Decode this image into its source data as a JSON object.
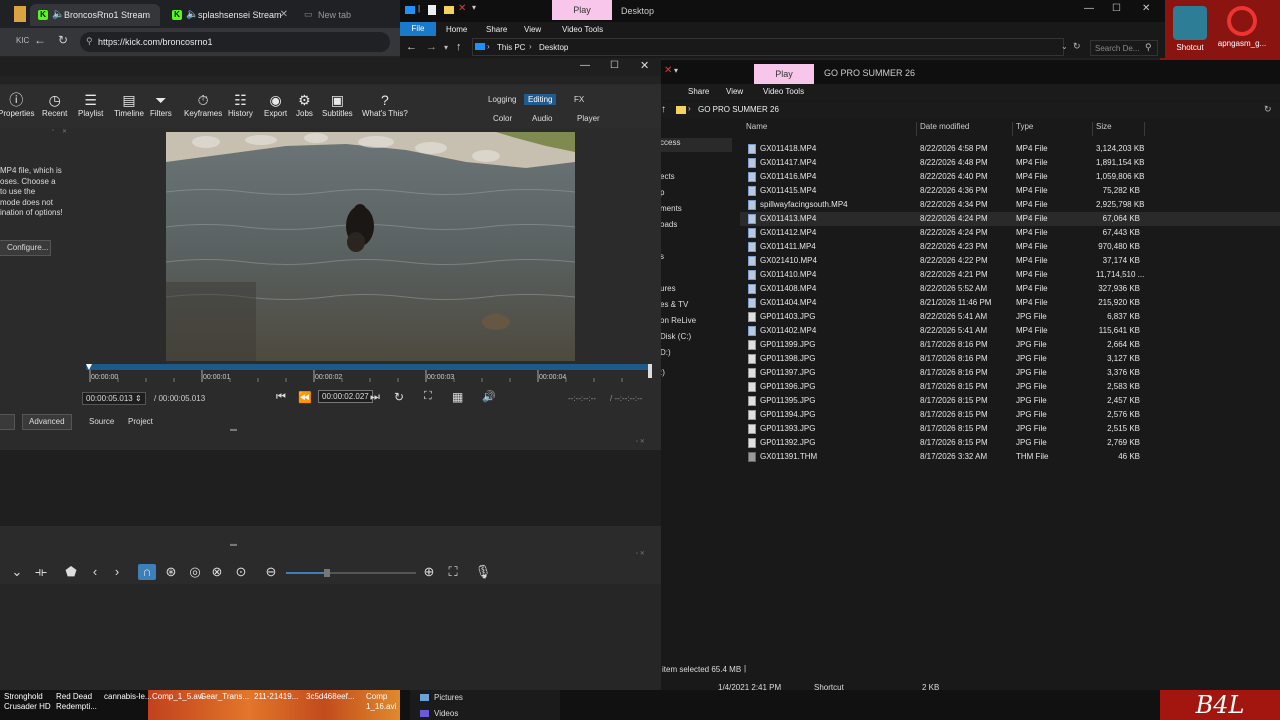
{
  "browser": {
    "tabs": [
      {
        "label": "BroncosRno1 Stream",
        "active": true
      },
      {
        "label": "splashsensei Stream",
        "active": false
      },
      {
        "label": "New tab",
        "active": false
      }
    ],
    "url": "https://kick.com/broncosrno1"
  },
  "explorer_top": {
    "play_tab": "Play",
    "title": "Desktop",
    "ribbon": [
      "File",
      "Home",
      "Share",
      "View",
      "Video Tools"
    ],
    "breadcrumb": [
      "This PC",
      "Desktop"
    ],
    "search_placeholder": "Search De..."
  },
  "desktop_icons": [
    {
      "label": "Shotcut"
    },
    {
      "label": "apngasm_g..."
    }
  ],
  "explorer_gopro": {
    "play_tab": "Play",
    "title": "GO PRO SUMMER 26",
    "ribbon": [
      "Share",
      "View",
      "Video Tools"
    ],
    "address": "GO PRO SUMMER 26",
    "nav_items": [
      "ccess",
      "ects",
      "p",
      "ments",
      "oads",
      "s",
      "ures",
      "es & TV",
      "on ReLive",
      "Disk (C:)",
      "D:)",
      ":)"
    ],
    "columns": [
      "Name",
      "Date modified",
      "Type",
      "Size"
    ],
    "files": [
      {
        "name": "GX011418.MP4",
        "date": "8/22/2026 4:58 PM",
        "type": "MP4 File",
        "size": "3,124,203 KB",
        "icon": "mp4"
      },
      {
        "name": "GX011417.MP4",
        "date": "8/22/2026 4:48 PM",
        "type": "MP4 File",
        "size": "1,891,154 KB",
        "icon": "mp4"
      },
      {
        "name": "GX011416.MP4",
        "date": "8/22/2026 4:40 PM",
        "type": "MP4 File",
        "size": "1,059,806 KB",
        "icon": "mp4"
      },
      {
        "name": "GX011415.MP4",
        "date": "8/22/2026 4:36 PM",
        "type": "MP4 File",
        "size": "75,282 KB",
        "icon": "mp4"
      },
      {
        "name": "spillwayfacingsouth.MP4",
        "date": "8/22/2026 4:34 PM",
        "type": "MP4 File",
        "size": "2,925,798 KB",
        "icon": "mp4"
      },
      {
        "name": "GX011413.MP4",
        "date": "8/22/2026 4:24 PM",
        "type": "MP4 File",
        "size": "67,064 KB",
        "icon": "mp4",
        "selected": true
      },
      {
        "name": "GX011412.MP4",
        "date": "8/22/2026 4:24 PM",
        "type": "MP4 File",
        "size": "67,443 KB",
        "icon": "mp4"
      },
      {
        "name": "GX011411.MP4",
        "date": "8/22/2026 4:23 PM",
        "type": "MP4 File",
        "size": "970,480 KB",
        "icon": "mp4"
      },
      {
        "name": "GX021410.MP4",
        "date": "8/22/2026 4:22 PM",
        "type": "MP4 File",
        "size": "37,174 KB",
        "icon": "mp4"
      },
      {
        "name": "GX011410.MP4",
        "date": "8/22/2026 4:21 PM",
        "type": "MP4 File",
        "size": "11,714,510 ...",
        "icon": "mp4"
      },
      {
        "name": "GX011408.MP4",
        "date": "8/22/2026 5:52 AM",
        "type": "MP4 File",
        "size": "327,936 KB",
        "icon": "mp4"
      },
      {
        "name": "GX011404.MP4",
        "date": "8/21/2026 11:46 PM",
        "type": "MP4 File",
        "size": "215,920 KB",
        "icon": "mp4"
      },
      {
        "name": "GP011403.JPG",
        "date": "8/22/2026 5:41 AM",
        "type": "JPG File",
        "size": "6,837 KB",
        "icon": "jpg"
      },
      {
        "name": "GX011402.MP4",
        "date": "8/22/2026 5:41 AM",
        "type": "MP4 File",
        "size": "115,641 KB",
        "icon": "mp4"
      },
      {
        "name": "GP011399.JPG",
        "date": "8/17/2026 8:16 PM",
        "type": "JPG File",
        "size": "2,664 KB",
        "icon": "jpg"
      },
      {
        "name": "GP011398.JPG",
        "date": "8/17/2026 8:16 PM",
        "type": "JPG File",
        "size": "3,127 KB",
        "icon": "jpg"
      },
      {
        "name": "GP011397.JPG",
        "date": "8/17/2026 8:16 PM",
        "type": "JPG File",
        "size": "3,376 KB",
        "icon": "jpg"
      },
      {
        "name": "GP011396.JPG",
        "date": "8/17/2026 8:15 PM",
        "type": "JPG File",
        "size": "2,583 KB",
        "icon": "jpg"
      },
      {
        "name": "GP011395.JPG",
        "date": "8/17/2026 8:15 PM",
        "type": "JPG File",
        "size": "2,457 KB",
        "icon": "jpg"
      },
      {
        "name": "GP011394.JPG",
        "date": "8/17/2026 8:15 PM",
        "type": "JPG File",
        "size": "2,576 KB",
        "icon": "jpg"
      },
      {
        "name": "GP011393.JPG",
        "date": "8/17/2026 8:15 PM",
        "type": "JPG File",
        "size": "2,515 KB",
        "icon": "jpg"
      },
      {
        "name": "GP011392.JPG",
        "date": "8/17/2026 8:15 PM",
        "type": "JPG File",
        "size": "2,769 KB",
        "icon": "jpg"
      },
      {
        "name": "GX011391.THM",
        "date": "8/17/2026 3:32 AM",
        "type": "THM File",
        "size": "46 KB",
        "icon": "thm"
      }
    ],
    "status": "item selected  65.4 MB",
    "bottom_row": {
      "date": "1/4/2021 2:41 PM",
      "type": "Shortcut",
      "size": "2 KB"
    }
  },
  "shotcut": {
    "toolbar": [
      {
        "label": "Properties",
        "icon": "properties-icon",
        "glyph": "ⓘ"
      },
      {
        "label": "Recent",
        "icon": "clock-icon",
        "glyph": "◷"
      },
      {
        "label": "Playlist",
        "icon": "list-icon",
        "glyph": "☰"
      },
      {
        "label": "Timeline",
        "icon": "timeline-icon",
        "glyph": "▤"
      },
      {
        "label": "Filters",
        "icon": "filter-icon",
        "glyph": "⏷"
      },
      {
        "label": "Keyframes",
        "icon": "stopwatch-icon",
        "glyph": "⏱"
      },
      {
        "label": "History",
        "icon": "history-icon",
        "glyph": "☷"
      },
      {
        "label": "Export",
        "icon": "export-icon",
        "glyph": "◉"
      },
      {
        "label": "Jobs",
        "icon": "gear-icon",
        "glyph": "⚙"
      },
      {
        "label": "Subtitles",
        "icon": "subtitles-icon",
        "glyph": "▣"
      },
      {
        "label": "What's This?",
        "icon": "help-icon",
        "glyph": "?"
      }
    ],
    "layouts_row1": [
      "Logging",
      "Editing",
      "FX"
    ],
    "layouts_row2": [
      "Color",
      "Audio",
      "Player"
    ],
    "active_layout": "Editing",
    "left_text": [
      "MP4 file, which is",
      "oses. Choose a",
      "to use the",
      "mode does not",
      "ination of options!"
    ],
    "configure_button": "Configure...",
    "ruler_labels": [
      "00:00:00",
      "00:00:01",
      "00:00:02",
      "00:00:03",
      "00:00:04"
    ],
    "timecode_duration": "00:00:05.013",
    "timecode_total": "/ 00:00:05.013",
    "timecode_current": "00:00:02.027",
    "in_point": "--:--:--:--",
    "out_point": "/ --:--:--:--",
    "panel_tabs": [
      "Advanced",
      "Source",
      "Project"
    ]
  },
  "taskbar": {
    "items": [
      {
        "label": "Stronghold Crusader HD"
      },
      {
        "label": "Red Dead Redempti..."
      },
      {
        "label": "cannabis-le..."
      },
      {
        "label": "Comp_1_5.avi"
      },
      {
        "label": "Gear_Trans..."
      },
      {
        "label": "211-21419..."
      },
      {
        "label": "3c5d468eef..."
      },
      {
        "label": "Comp 1_16.avi"
      }
    ],
    "folders": [
      "Pictures",
      "Videos"
    ],
    "logo": "B4L"
  },
  "colors": {
    "accent": "#215a8c",
    "kick_green": "#53fc18",
    "play_tab": "#f7c6ea",
    "desktop_red": "#8a1410"
  }
}
